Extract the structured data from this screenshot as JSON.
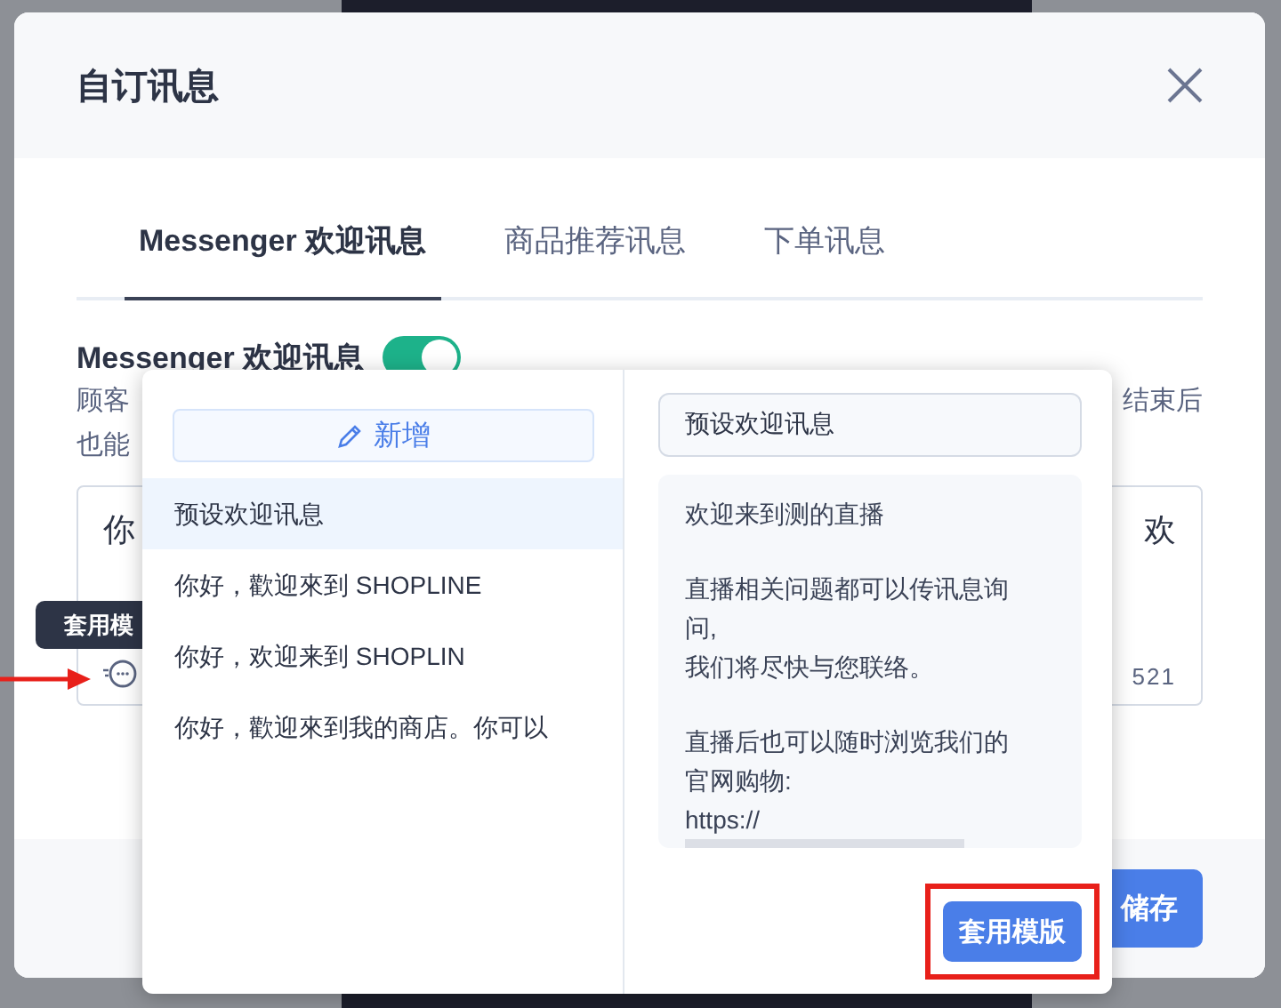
{
  "dialog": {
    "title": "自订讯息"
  },
  "tabs": [
    {
      "label": "Messenger 欢迎讯息",
      "selected": true
    },
    {
      "label": "商品推荐讯息",
      "selected": false
    },
    {
      "label": "下单讯息",
      "selected": false
    }
  ],
  "welcome": {
    "label": "Messenger 欢迎讯息",
    "on": true,
    "description_left": [
      "顾客",
      "也能"
    ],
    "description_right": "结束后",
    "message_start": "你",
    "message_end": "欢",
    "count": "521"
  },
  "tooltip": "套用模",
  "save_button": "储存",
  "template_picker": {
    "add_button": "新增",
    "templates": [
      {
        "label": "预设欢迎讯息",
        "selected": true
      },
      {
        "label": "你好，歡迎來到 SHOPLINE",
        "selected": false
      },
      {
        "label": "你好，欢迎来到 SHOPLIN",
        "selected": false
      },
      {
        "label": "你好，歡迎來到我的商店。你可以",
        "selected": false
      }
    ],
    "name_field": {
      "value": "预设欢迎讯息"
    },
    "preview": [
      [
        "欢迎来到测的直播"
      ],
      [
        "直播相关问题都可以传讯息询问,",
        "我们将尽快与您联络。"
      ],
      [
        "直播后也可以随时浏览我们的官网购物:",
        "https://"
      ]
    ],
    "apply_button": "套用模版"
  }
}
